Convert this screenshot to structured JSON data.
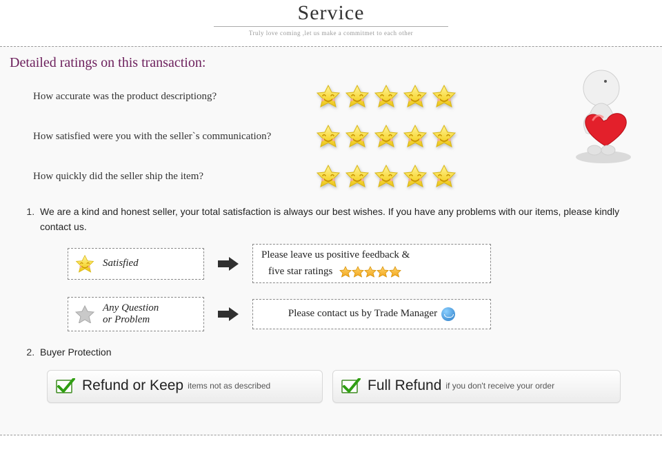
{
  "header": {
    "title": "Service",
    "subtitle": "Truly love coming ,let us make a commitmet to each other"
  },
  "section_heading": "Detailed ratings on this transaction:",
  "ratings": [
    {
      "question": "How accurate was the product descriptiong?",
      "stars": 5
    },
    {
      "question": "How satisfied were you with the seller`s communication?",
      "stars": 5
    },
    {
      "question": "How quickly did the seller ship the item?",
      "stars": 5
    }
  ],
  "notes": {
    "item1": "We are a kind and honest seller, your total satisfaction is always our best wishes. If you have any problems with our items, please kindly contact us.",
    "item2_title": "Buyer Protection"
  },
  "feedback": {
    "satisfied_label": "Satisfied",
    "satisfied_action_l1": "Please leave us positive feedback &",
    "satisfied_action_l2": "five star ratings",
    "question_label_l1": "Any Question",
    "question_label_l2": "or Problem",
    "question_action": "Please contact us by Trade Manager"
  },
  "protection": {
    "refund_keep_main": "Refund or Keep",
    "refund_keep_sub": "items not as described",
    "full_refund_main": "Full Refund",
    "full_refund_sub": "if you don't receive your order"
  }
}
